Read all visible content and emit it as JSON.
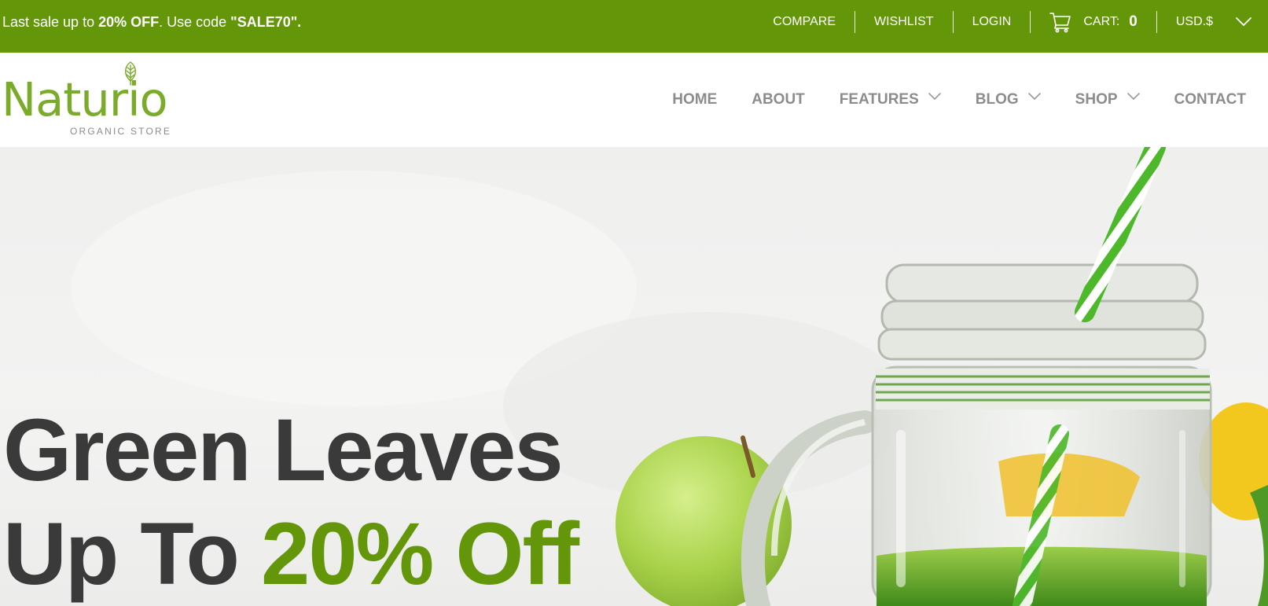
{
  "topbar": {
    "promo": {
      "text_1": "Last sale up to ",
      "bold_1": "20% OFF",
      "text_2": ". Use code ",
      "bold_2": "\"SALE70\"."
    },
    "links": {
      "compare": "COMPARE",
      "wishlist": "WISHLIST",
      "login": "LOGIN",
      "cart_label": "CART:",
      "cart_count": "0",
      "currency": "USD.$"
    },
    "bg_color": "#64960a"
  },
  "header": {
    "logo": {
      "name": "Naturio",
      "subtitle": "ORGANIC STORE"
    },
    "nav": {
      "home": "HOME",
      "about": "ABOUT",
      "features": "FEATURES",
      "blog": "BLOG",
      "shop": "SHOP",
      "contact": "CONTACT"
    }
  },
  "hero": {
    "line_1": "Green Leaves",
    "line_2_prefix": "Up To ",
    "line_2_accent": "20% Off",
    "accent_color": "#64960a"
  },
  "icons": {
    "cart": "cart-icon",
    "currency_dropdown": "chevron-down-icon",
    "nav_dropdown": "chevron-down-icon",
    "logo_leaf": "leaf-icon"
  }
}
